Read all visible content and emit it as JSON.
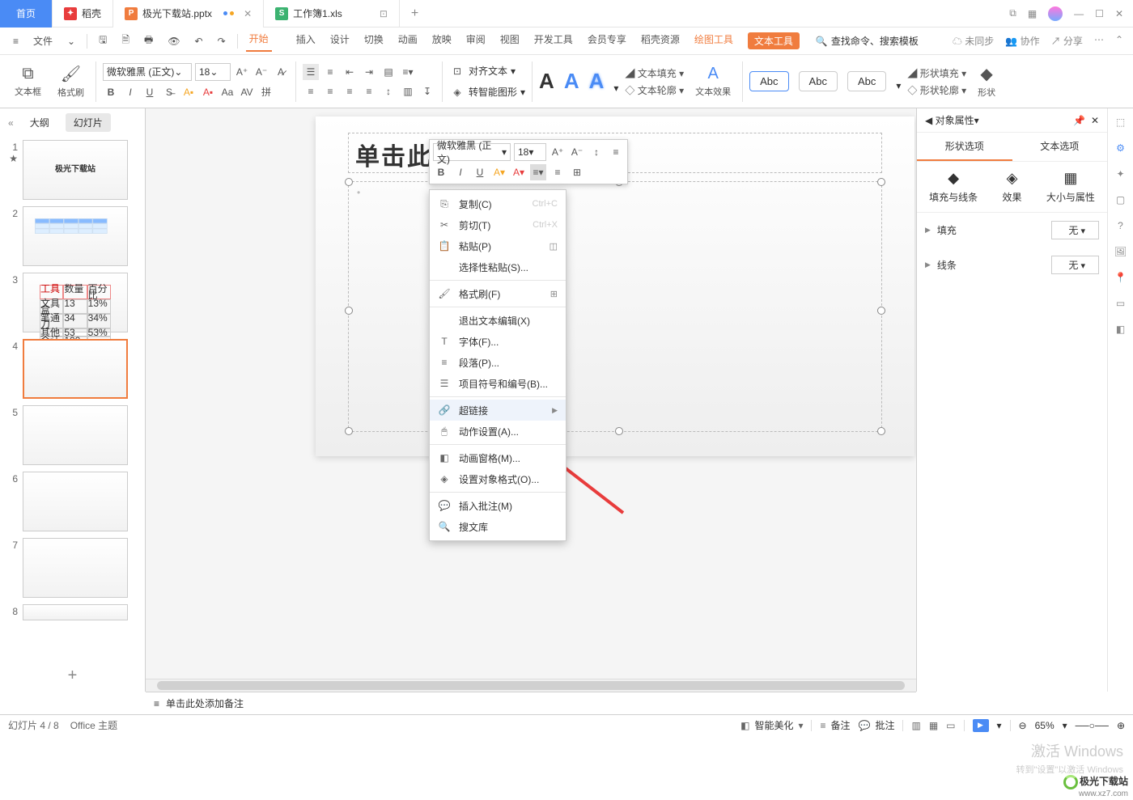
{
  "titlebar": {
    "tabs": [
      {
        "label": "首页",
        "type": "home"
      },
      {
        "label": "稻壳",
        "icon": "d"
      },
      {
        "label": "极光下载站.pptx",
        "icon": "p",
        "active": true,
        "modified": true
      },
      {
        "label": "工作簿1.xls",
        "icon": "s"
      }
    ],
    "window": {
      "grid": "⊞",
      "apps": "⊟"
    }
  },
  "qat": {
    "file": "文件",
    "menu": [
      "插入",
      "设计",
      "切换",
      "动画",
      "放映",
      "审阅",
      "视图",
      "开发工具",
      "会员专享",
      "稻壳资源"
    ],
    "hot1": "绘图工具",
    "hot2": "文本工具",
    "search_placeholder": "查找命令、搜索模板",
    "right": [
      "未同步",
      "协作",
      "分享"
    ]
  },
  "ribbon": {
    "textbox": "文本框",
    "brush": "格式刷",
    "font": "微软雅黑 (正文)",
    "size": "18",
    "align": "对齐文本",
    "smart": "转智能图形",
    "fill": "文本填充",
    "outline": "文本轮廓",
    "effect": "文本效果",
    "abc": "Abc",
    "shape_fill": "形状填充",
    "shape_outline": "形状轮廓",
    "shape_more": "形状"
  },
  "sidepanel": {
    "t1": "大纲",
    "t2": "幻灯片",
    "slide1_title": "极光下载站"
  },
  "slide": {
    "title": "单击此处添加标题"
  },
  "mini": {
    "font": "微软雅黑 (正文)",
    "size": "18"
  },
  "ctx": {
    "copy": "复制(C)",
    "copy_sc": "Ctrl+C",
    "cut": "剪切(T)",
    "cut_sc": "Ctrl+X",
    "paste": "粘贴(P)",
    "paste_special": "选择性粘贴(S)...",
    "brush": "格式刷(F)",
    "exit": "退出文本编辑(X)",
    "font": "字体(F)...",
    "para": "段落(P)...",
    "bullets": "项目符号和编号(B)...",
    "link": "超链接",
    "action": "动作设置(A)...",
    "anim": "动画窗格(M)...",
    "format": "设置对象格式(O)...",
    "comment": "插入批注(M)",
    "search": "搜文库"
  },
  "prop": {
    "title": "对象属性",
    "t1": "形状选项",
    "t2": "文本选项",
    "s1": "填充与线条",
    "s2": "效果",
    "s3": "大小与属性",
    "fill": "填充",
    "line": "线条",
    "none": "无"
  },
  "notes": "单击此处添加备注",
  "status": {
    "page": "幻灯片 4 / 8",
    "theme": "Office 主题",
    "smart": "智能美化",
    "notes": "备注",
    "comment": "批注",
    "zoom": "65%"
  },
  "wm1": "激活 Windows",
  "wm2": "转到\"设置\"以激活 Windows",
  "logo": "极光下载站",
  "logo_url": "www.xz7.com"
}
